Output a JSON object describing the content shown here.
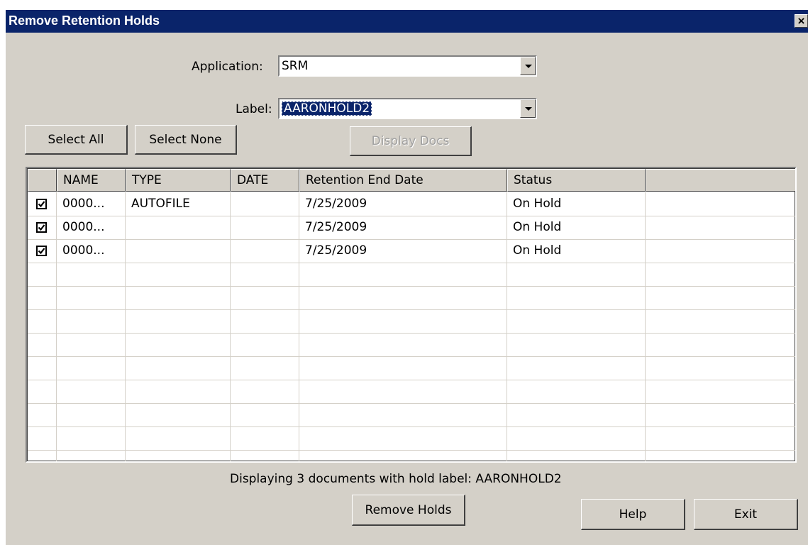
{
  "window": {
    "title": "Remove Retention Holds",
    "close_label": "✕"
  },
  "form": {
    "application_label": "Application:",
    "application_value": "SRM",
    "label_label": "Label:",
    "label_value": "AARONHOLD2"
  },
  "buttons": {
    "select_all": "Select All",
    "select_none": "Select None",
    "display_docs": "Display Docs",
    "remove_holds": "Remove Holds",
    "help": "Help",
    "exit": "Exit"
  },
  "table": {
    "columns": [
      "",
      "NAME",
      "TYPE",
      "DATE",
      "Retention End Date",
      "Status",
      ""
    ],
    "rows": [
      {
        "checked": true,
        "name": "0000...",
        "type": "AUTOFILE",
        "date": "",
        "retention_end_date": "7/25/2009",
        "status": "On Hold"
      },
      {
        "checked": true,
        "name": "0000...",
        "type": "",
        "date": "",
        "retention_end_date": "7/25/2009",
        "status": "On Hold"
      },
      {
        "checked": true,
        "name": "0000...",
        "type": "",
        "date": "",
        "retention_end_date": "7/25/2009",
        "status": "On Hold"
      }
    ]
  },
  "status_text": "Displaying 3 documents with hold label: AARONHOLD2",
  "colors": {
    "titlebar": "#0a246a",
    "dialog_bg": "#d4d0c8",
    "selection": "#0a246a"
  }
}
